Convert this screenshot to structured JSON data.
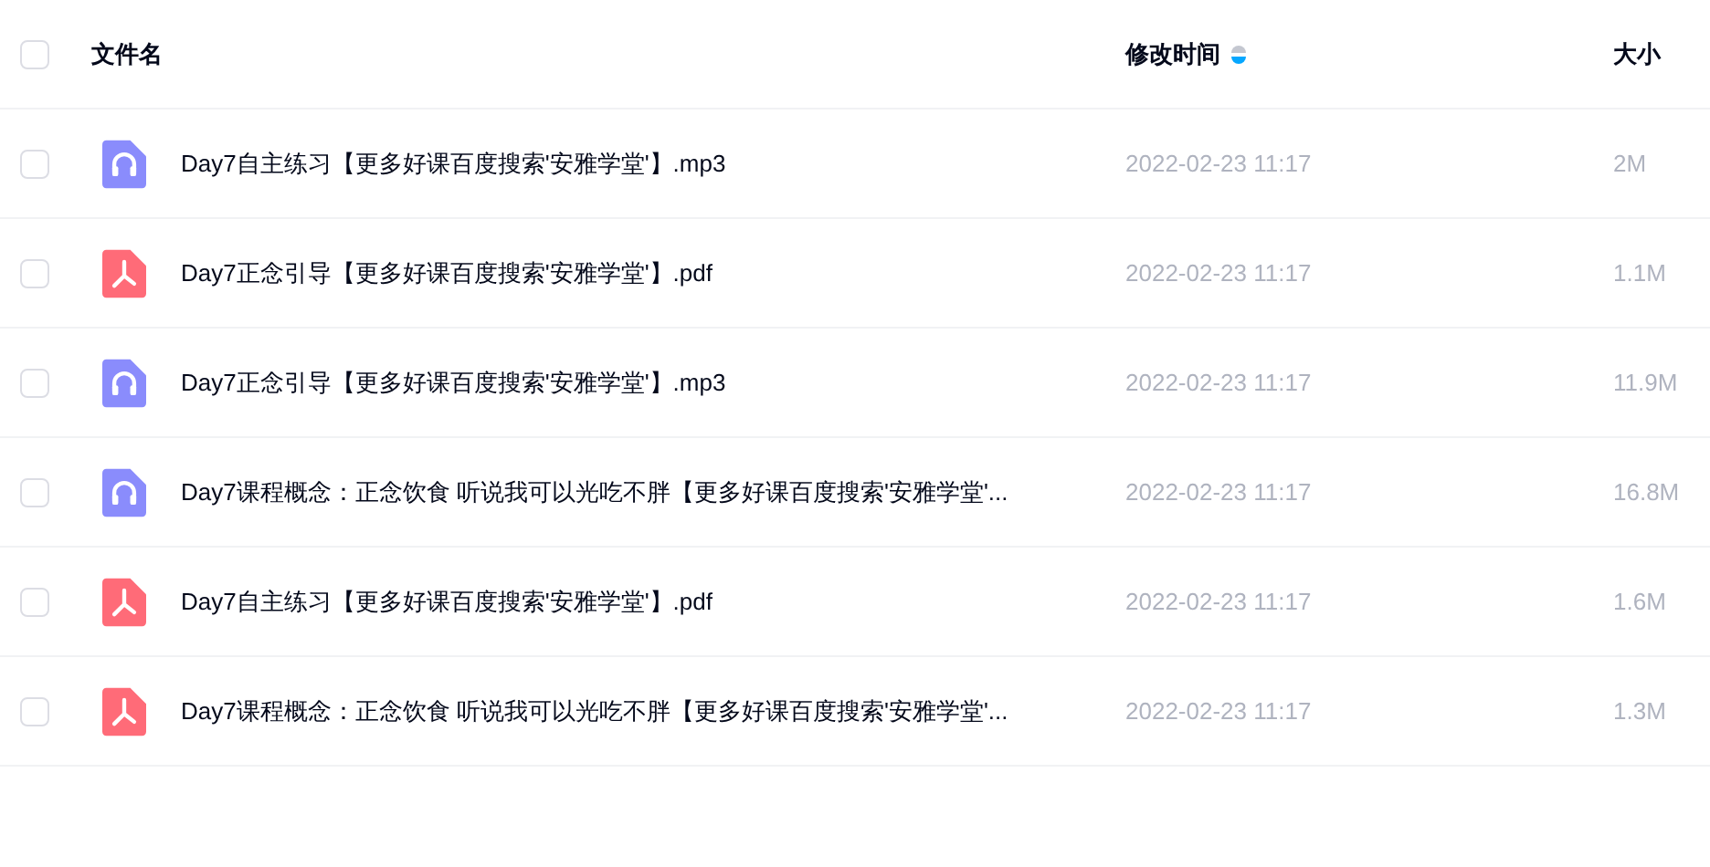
{
  "table": {
    "select_all": {
      "checked": false
    },
    "columns": [
      {
        "label": "文件名"
      },
      {
        "label": "修改时间",
        "sort_descending": true
      },
      {
        "label": "大小"
      }
    ],
    "rows": [
      {
        "kind": "audio",
        "checked": false,
        "name": "Day7自主练习【更多好课百度搜索'安雅学堂'】.mp3",
        "modified": "2022-02-23 11:17",
        "size": "2M"
      },
      {
        "kind": "pdf",
        "checked": false,
        "name": "Day7正念引导【更多好课百度搜索'安雅学堂'】.pdf",
        "modified": "2022-02-23 11:17",
        "size": "1.1M"
      },
      {
        "kind": "audio",
        "checked": false,
        "name": "Day7正念引导【更多好课百度搜索'安雅学堂'】.mp3",
        "modified": "2022-02-23 11:17",
        "size": "11.9M"
      },
      {
        "kind": "audio",
        "checked": false,
        "name": "Day7课程概念：正念饮食 听说我可以光吃不胖【更多好课百度搜索'安雅学堂'...",
        "modified": "2022-02-23 11:17",
        "size": "16.8M"
      },
      {
        "kind": "pdf",
        "checked": false,
        "name": "Day7自主练习【更多好课百度搜索'安雅学堂'】.pdf",
        "modified": "2022-02-23 11:17",
        "size": "1.6M"
      },
      {
        "kind": "pdf",
        "checked": false,
        "name": "Day7课程概念：正念饮食 听说我可以光吃不胖【更多好课百度搜索'安雅学堂'...",
        "modified": "2022-02-23 11:17",
        "size": "1.3M"
      }
    ]
  }
}
